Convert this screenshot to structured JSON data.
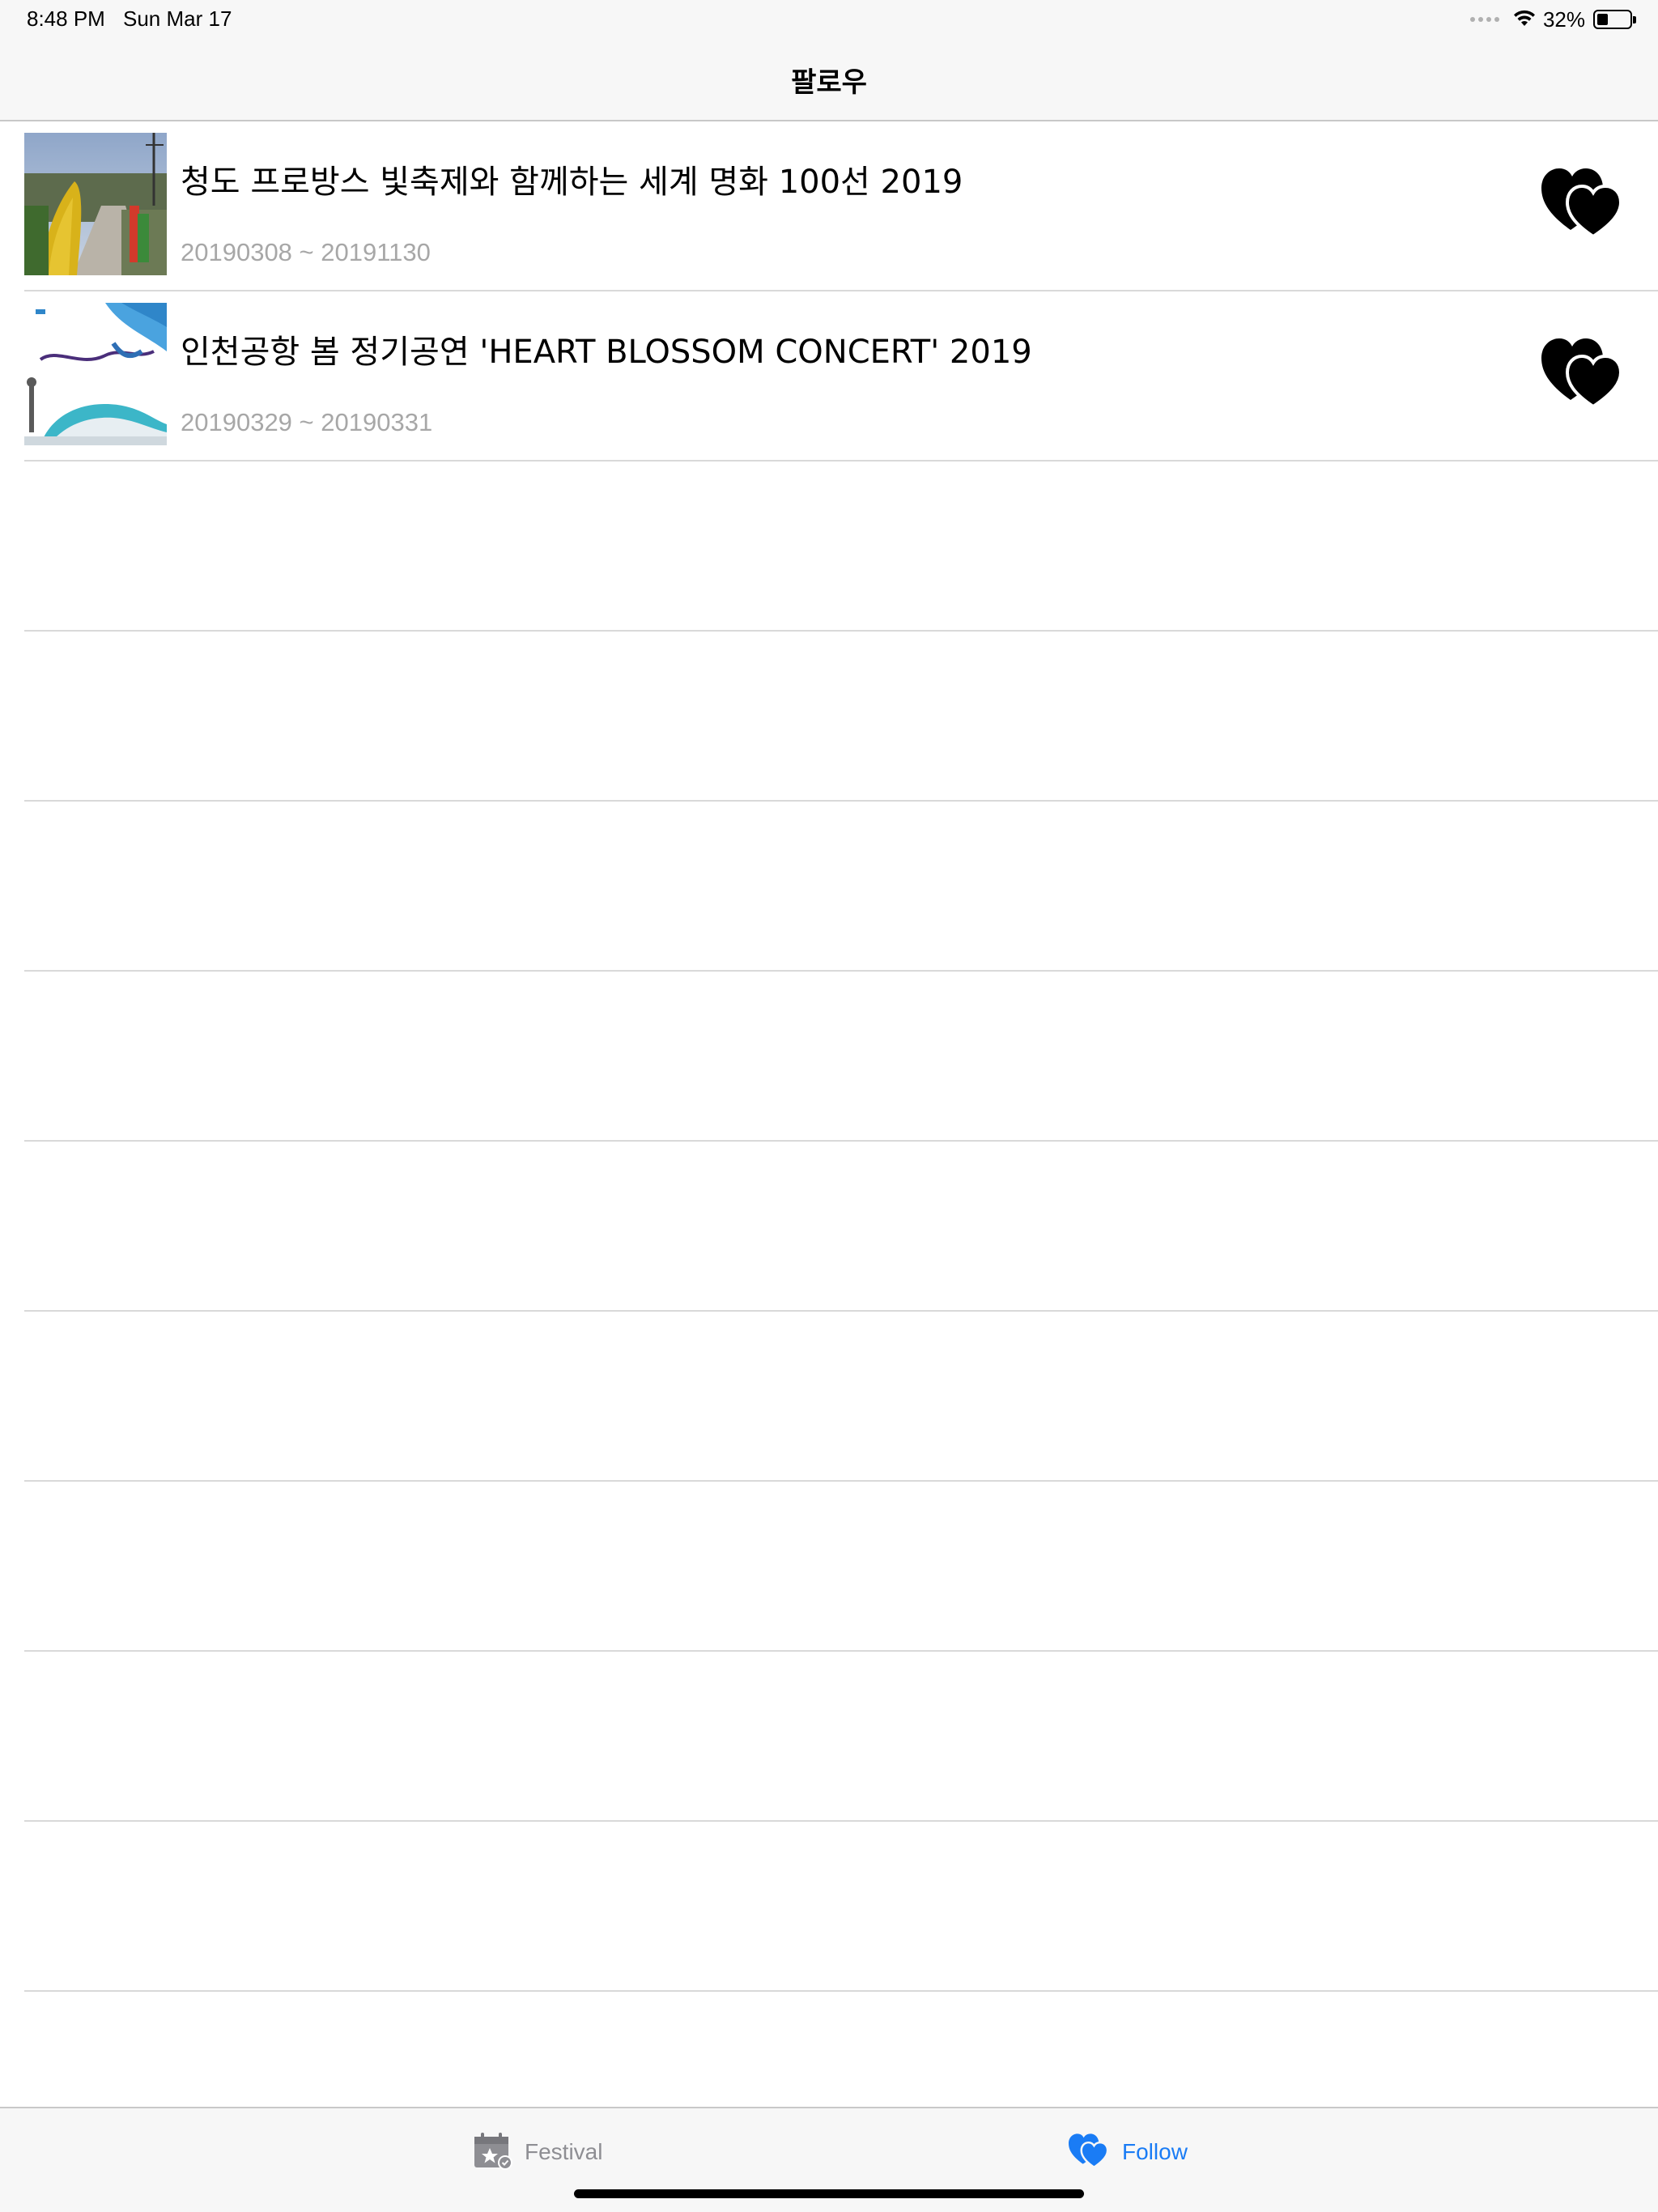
{
  "status_bar": {
    "time": "8:48 PM",
    "date": "Sun Mar 17",
    "battery_percent_label": "32%",
    "battery_level": 0.32
  },
  "nav": {
    "title": "팔로우"
  },
  "items": [
    {
      "title": "청도 프로방스 빛축제와 함께하는 세계 명화 100선 2019",
      "dates": "20190308 ~ 20191130",
      "thumbnail": "festival-photo-flower-arch",
      "followed": true
    },
    {
      "title": "인천공항 봄 정기공연 'HEART BLOSSOM CONCERT' 2019",
      "dates": "20190329 ~ 20190331",
      "thumbnail": "airport-concert-poster",
      "followed": true
    }
  ],
  "tabs": [
    {
      "label": "Festival",
      "icon": "calendar-star-icon",
      "selected": false
    },
    {
      "label": "Follow",
      "icon": "hearts-icon",
      "selected": true
    }
  ],
  "colors": {
    "accent": "#1a7cf5",
    "inactive": "#8e8e93",
    "separator": "#d9d9d9",
    "bar_background": "#f7f7f7",
    "secondary_text": "#a7a7a7"
  }
}
